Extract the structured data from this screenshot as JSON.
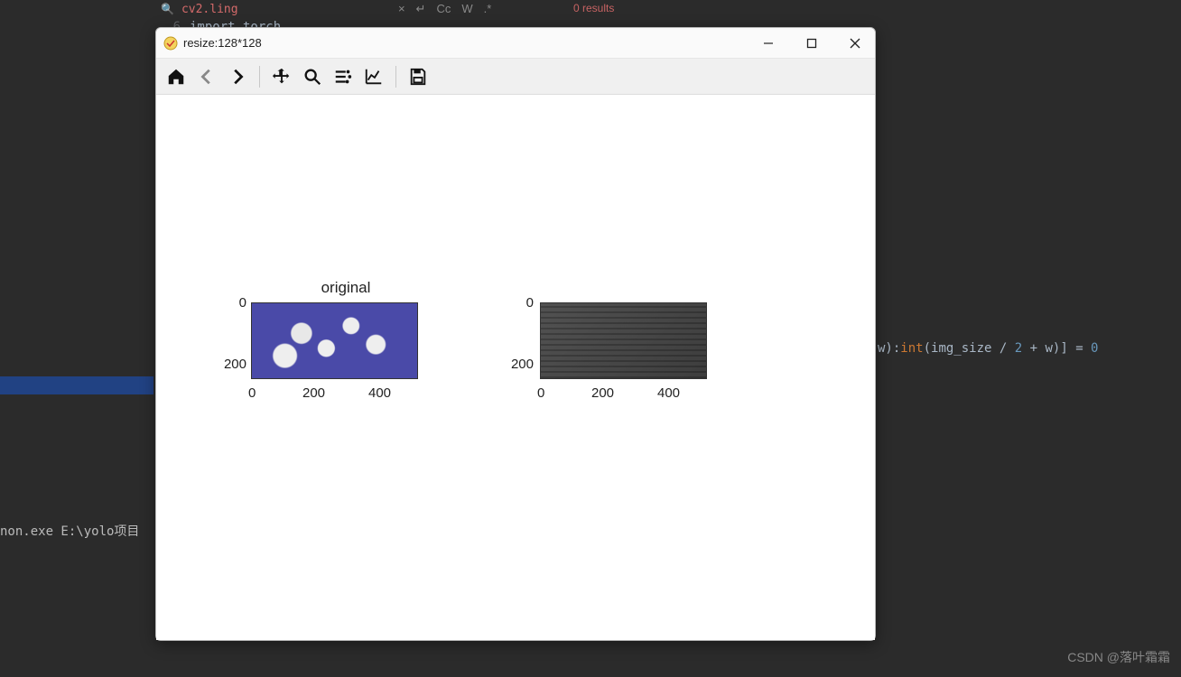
{
  "editor": {
    "search_text": "cv2.ling",
    "search_results": "0 results",
    "code_line_num": "6",
    "code_line_text": "import torch",
    "term_line": "non.exe  E:\\yolo项目",
    "code_fragment": {
      "p1": "w):",
      "int": "int",
      "p2": "(img_size / ",
      "num": "2",
      "p3": " + w)] = ",
      "zero": "0"
    }
  },
  "mpl": {
    "title": "resize:128*128",
    "subplot1_title": "original",
    "ticks": {
      "y0": "0",
      "y200": "200",
      "x0": "0",
      "x200": "200",
      "x400": "400"
    }
  },
  "chart_data": [
    {
      "type": "heatmap",
      "title": "original",
      "xlabel": "",
      "ylabel": "",
      "xlim": [
        0,
        500
      ],
      "ylim": [
        0,
        250
      ],
      "xticks": [
        0,
        200,
        400
      ],
      "yticks": [
        0,
        200
      ],
      "description": "color image (pills on blue background)"
    },
    {
      "type": "heatmap",
      "title": "",
      "xlabel": "",
      "ylabel": "",
      "xlim": [
        0,
        500
      ],
      "ylim": [
        0,
        250
      ],
      "xticks": [
        0,
        200,
        400
      ],
      "yticks": [
        0,
        200
      ],
      "description": "grayscale resized/processed version"
    }
  ],
  "watermark": "CSDN @落叶霜霜"
}
